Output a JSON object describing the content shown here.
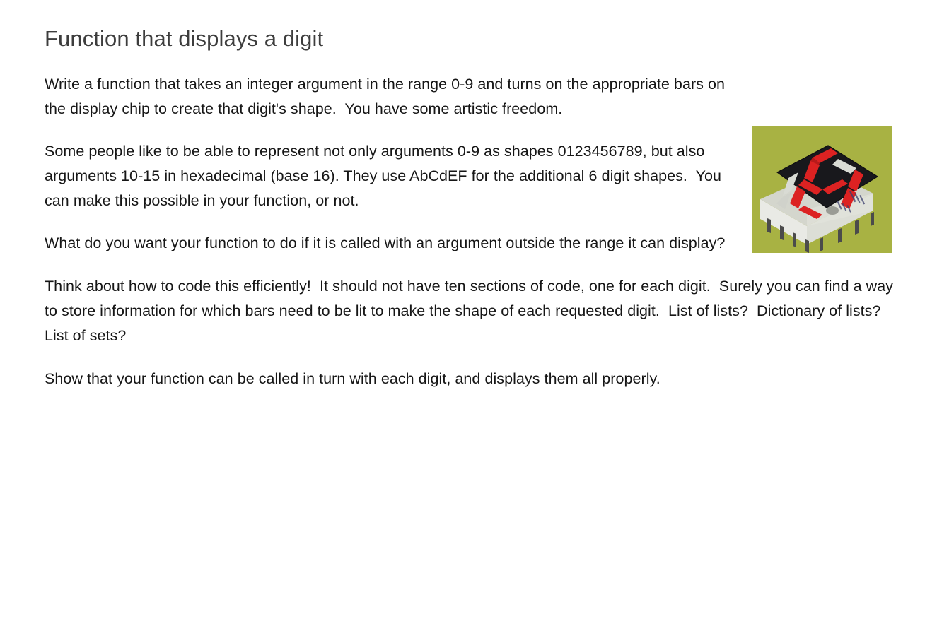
{
  "document": {
    "title": "Function that displays a digit",
    "paragraphs": [
      "Write a function that takes an integer argument in the range 0-9 and turns on the appropriate bars on the display chip to create that digit's shape.  You have some artistic freedom.",
      "Some people like to be able to represent not only arguments 0-9 as shapes 0123456789, but also arguments 10-15 in hexadecimal (base 16). They use AbCdEF for the additional 6 digit shapes.  You can make this possible in your function, or not.",
      "What do you want your function to do if it is called with an argument outside the range it can display?",
      "Think about how to code this efficiently!  It should not have ten sections of code, one for each digit.  Surely you can find a way to store information for which bars need to be lit to make the shape of each requested digit.  List of lists?  Dictionary of lists?  List of sets?",
      "Show that your function can be called in turn with each digit, and displays them all properly."
    ]
  },
  "figure": {
    "name": "seven-segment-display-photo",
    "alt": "Seven-segment LED display chip with some bars lit red",
    "colors": {
      "background": "#a8b243",
      "chip_face": "#16161a",
      "chip_body": "#e8e9e4",
      "chip_body_shadow": "#c9cbc2",
      "segment_on": "#dc2222",
      "segment_off": "#d9dbd4",
      "pin": "#4a4a4a"
    }
  }
}
